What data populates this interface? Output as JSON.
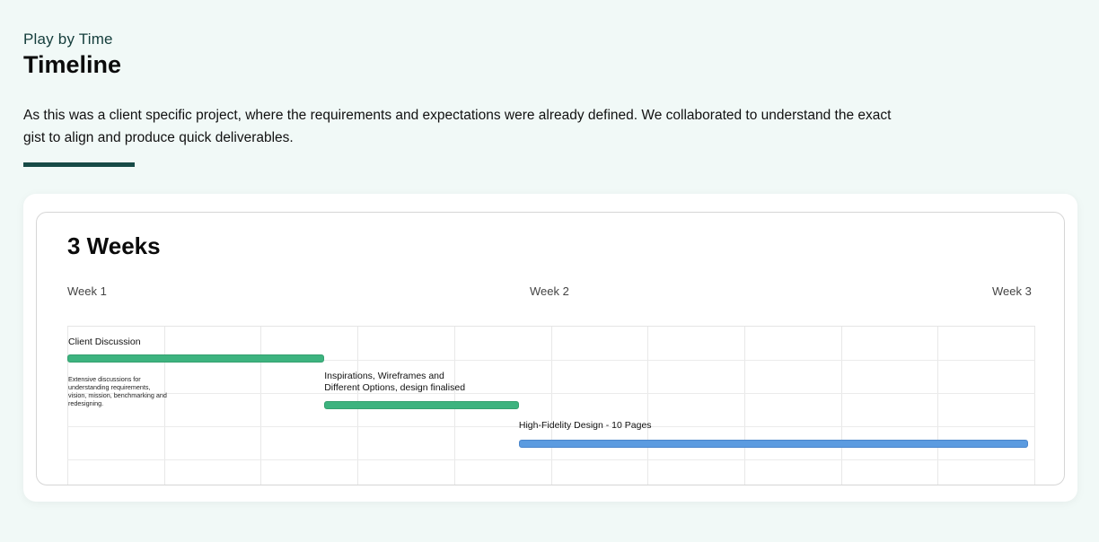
{
  "header": {
    "eyebrow": "Play by Time",
    "title": "Timeline",
    "description": "As this was a client specific project, where the requirements and expectations were already defined. We collaborated to understand the exact gist to align and produce quick deliverables."
  },
  "colors": {
    "accent": "#174a46",
    "green": "#3db37f",
    "blue": "#5b9be0"
  },
  "chart_data": {
    "type": "gantt",
    "title": "3 Weeks",
    "x_axis": [
      "Week 1",
      "Week 2",
      "Week 3"
    ],
    "xlim": [
      1,
      3
    ],
    "tasks": [
      {
        "name": "Client Discussion",
        "description": "Extensive discussions for understanding requirements, vision, mission,  benchmarking and redesigning.",
        "start": 1.0,
        "end": 1.535,
        "color": "#3db37f"
      },
      {
        "name": "Inspirations, Wireframes and Different Options, design finalised",
        "name_lines": [
          "Inspirations, Wireframes and",
          "Different Options, design finalised"
        ],
        "start": 1.535,
        "end": 1.94,
        "color": "#3db37f"
      },
      {
        "name": "High-Fidelity Design - 10 Pages",
        "start": 1.94,
        "end": 3.0,
        "color": "#5b9be0"
      }
    ]
  }
}
